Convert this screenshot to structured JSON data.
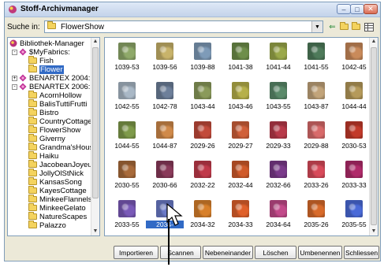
{
  "window": {
    "title": "Stoff-Archivmanager"
  },
  "search": {
    "label": "Suche in:",
    "value": "FlowerShow"
  },
  "tree": {
    "items": [
      {
        "label": "Bibliothek-Manager",
        "level": 0,
        "icon": "library-icon"
      },
      {
        "label": "$MyFabrics:",
        "level": 1,
        "icon": "fabric-icon",
        "expander": "-"
      },
      {
        "label": "Fish",
        "level": 2,
        "icon": "folder-icon"
      },
      {
        "label": "Flower",
        "level": 2,
        "icon": "folder-icon",
        "selected": true
      },
      {
        "label": "BENARTEX 2004:",
        "level": 1,
        "icon": "fabric-icon",
        "expander": "+"
      },
      {
        "label": "BENARTEX 2006:",
        "level": 1,
        "icon": "fabric-icon",
        "expander": "-"
      },
      {
        "label": "AcornHollow",
        "level": 2,
        "icon": "folder-icon"
      },
      {
        "label": "BalisTuttiFrutti",
        "level": 2,
        "icon": "folder-icon"
      },
      {
        "label": "Bistro",
        "level": 2,
        "icon": "folder-icon"
      },
      {
        "label": "CountryCottage",
        "level": 2,
        "icon": "folder-icon"
      },
      {
        "label": "FlowerShow",
        "level": 2,
        "icon": "folder-icon"
      },
      {
        "label": "Giverny",
        "level": 2,
        "icon": "folder-icon"
      },
      {
        "label": "Grandma'sHouse",
        "level": 2,
        "icon": "folder-icon"
      },
      {
        "label": "Haiku",
        "level": 2,
        "icon": "folder-icon"
      },
      {
        "label": "JacobeanJoyeux",
        "level": 2,
        "icon": "folder-icon"
      },
      {
        "label": "JollyOlStNick",
        "level": 2,
        "icon": "folder-icon"
      },
      {
        "label": "KansasSong",
        "level": 2,
        "icon": "folder-icon"
      },
      {
        "label": "KayesCottage",
        "level": 2,
        "icon": "folder-icon"
      },
      {
        "label": "MinkeeFlannels",
        "level": 2,
        "icon": "folder-icon"
      },
      {
        "label": "MinkeeGelato",
        "level": 2,
        "icon": "folder-icon"
      },
      {
        "label": "NatureScapes",
        "level": 2,
        "icon": "folder-icon"
      },
      {
        "label": "Palazzo",
        "level": 2,
        "icon": "folder-icon"
      }
    ]
  },
  "fabrics": [
    {
      "label": "1039-53",
      "color": "#8fa96a"
    },
    {
      "label": "1039-56",
      "color": "#c8b36a"
    },
    {
      "label": "1039-88",
      "color": "#7e9bb8"
    },
    {
      "label": "1041-38",
      "color": "#6e8e4a"
    },
    {
      "label": "1041-44",
      "color": "#9aa84a"
    },
    {
      "label": "1041-55",
      "color": "#4e7a5a"
    },
    {
      "label": "1042-45",
      "color": "#c98a5a"
    },
    {
      "label": "1042-55",
      "color": "#a9b8c6"
    },
    {
      "label": "1042-78",
      "color": "#6d7f9a"
    },
    {
      "label": "1043-44",
      "color": "#8a9a5a"
    },
    {
      "label": "1043-46",
      "color": "#b6b04a"
    },
    {
      "label": "1043-55",
      "color": "#5a8a6a"
    },
    {
      "label": "1043-87",
      "color": "#c2a47a"
    },
    {
      "label": "1044-44",
      "color": "#b59a5a"
    },
    {
      "label": "1044-55",
      "color": "#7e9a4a"
    },
    {
      "label": "1044-87",
      "color": "#d08a4a"
    },
    {
      "label": "2029-26",
      "color": "#c24a3a"
    },
    {
      "label": "2029-27",
      "color": "#d0603a"
    },
    {
      "label": "2029-33",
      "color": "#b83a4a"
    },
    {
      "label": "2029-88",
      "color": "#d86a6a"
    },
    {
      "label": "2030-53",
      "color": "#c23a2a"
    },
    {
      "label": "2030-55",
      "color": "#a86a3a"
    },
    {
      "label": "2030-66",
      "color": "#8a3a5a"
    },
    {
      "label": "2032-22",
      "color": "#c0394a"
    },
    {
      "label": "2032-44",
      "color": "#d05a2a"
    },
    {
      "label": "2032-66",
      "color": "#7a3a8a"
    },
    {
      "label": "2033-26",
      "color": "#d84a5a"
    },
    {
      "label": "2033-33",
      "color": "#b02a6a"
    },
    {
      "label": "2033-55",
      "color": "#7a5ab8"
    },
    {
      "label": "2034-",
      "color": "#6a7ac8",
      "selected": true
    },
    {
      "label": "2034-32",
      "color": "#d8802a"
    },
    {
      "label": "2034-33",
      "color": "#e0602a"
    },
    {
      "label": "2034-64",
      "color": "#c24a8a"
    },
    {
      "label": "2035-26",
      "color": "#d86a2a"
    },
    {
      "label": "2035-55",
      "color": "#4a6ad8"
    },
    {
      "label": "",
      "color": "#d87a3a"
    }
  ],
  "buttons": {
    "import": "Importieren",
    "scan": "Scannen",
    "side_by_side": "Nebeneinander",
    "delete": "Löschen",
    "rename": "Umbenennen",
    "close": "Schliessen"
  }
}
